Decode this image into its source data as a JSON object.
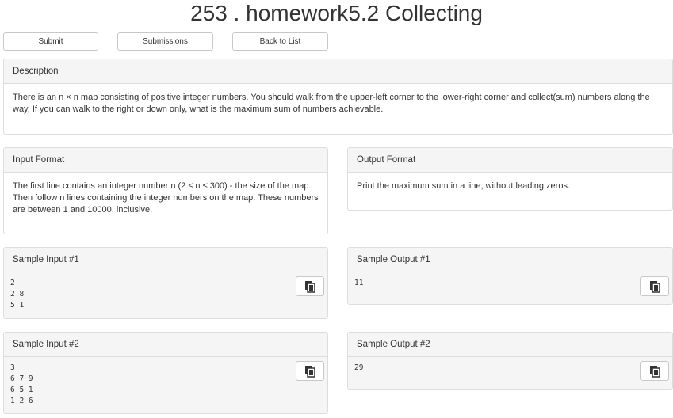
{
  "header": {
    "title": "253 . homework5.2 Collecting"
  },
  "toolbar": {
    "submit_label": "Submit",
    "submissions_label": "Submissions",
    "back_label": "Back to List"
  },
  "description": {
    "heading": "Description",
    "text": "There is an n × n map consisting of positive integer numbers. You should walk from the upper-left corner to the lower-right corner and collect(sum) numbers along the way. If you can walk to the right or down only, what is the maximum sum of numbers achievable."
  },
  "input_format": {
    "heading": "Input Format",
    "text": "The first line contains an integer number n (2 ≤ n ≤ 300) - the size of the map. Then follow n lines containing the integer numbers on the map. These numbers are between 1 and 10000, inclusive."
  },
  "output_format": {
    "heading": "Output Format",
    "text": "Print the maximum sum in a line, without leading zeros."
  },
  "samples": [
    {
      "input_heading": "Sample Input #1",
      "input": "2\n2 8\n5 1",
      "output_heading": "Sample Output #1",
      "output": "11"
    },
    {
      "input_heading": "Sample Input #2",
      "input": "3\n6 7 9\n6 5 1\n1 2 6",
      "output_heading": "Sample Output #2",
      "output": "29"
    }
  ],
  "icons": {
    "copy": "copy-icon"
  }
}
